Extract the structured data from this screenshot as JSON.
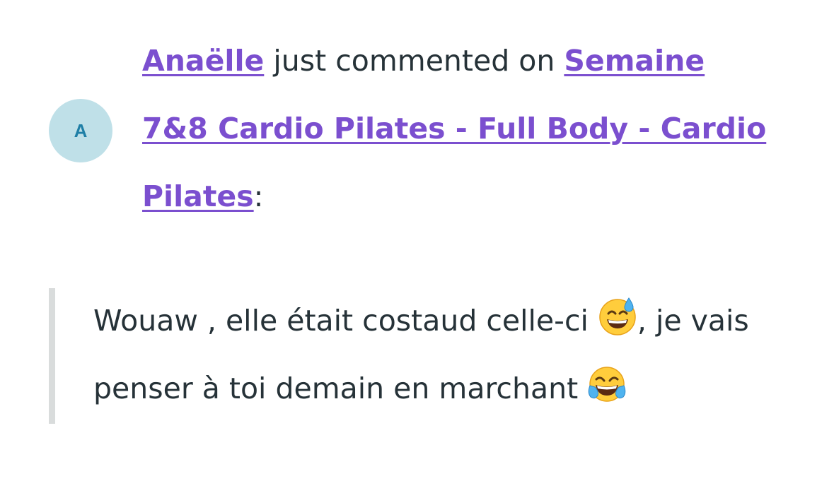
{
  "avatar": {
    "initial": "A",
    "background": "#bfe0e8",
    "text_color": "#1f7fa6"
  },
  "headline": {
    "author": "Anaëlle",
    "action": " just commented on ",
    "post_title": "Semaine 7&8 Cardio Pilates - Full Body - Cardio Pilates",
    "suffix": ":"
  },
  "comment": {
    "part1": "Wouaw , elle était costaud celle-ci ",
    "emoji1": "grinning-face-with-sweat-icon",
    "part2": ", je vais penser à toi demain en marchant ",
    "emoji2": "face-with-tears-of-joy-icon"
  },
  "colors": {
    "link": "#7b4fcf",
    "text": "#263238",
    "quote_border": "#d9dcdc"
  }
}
